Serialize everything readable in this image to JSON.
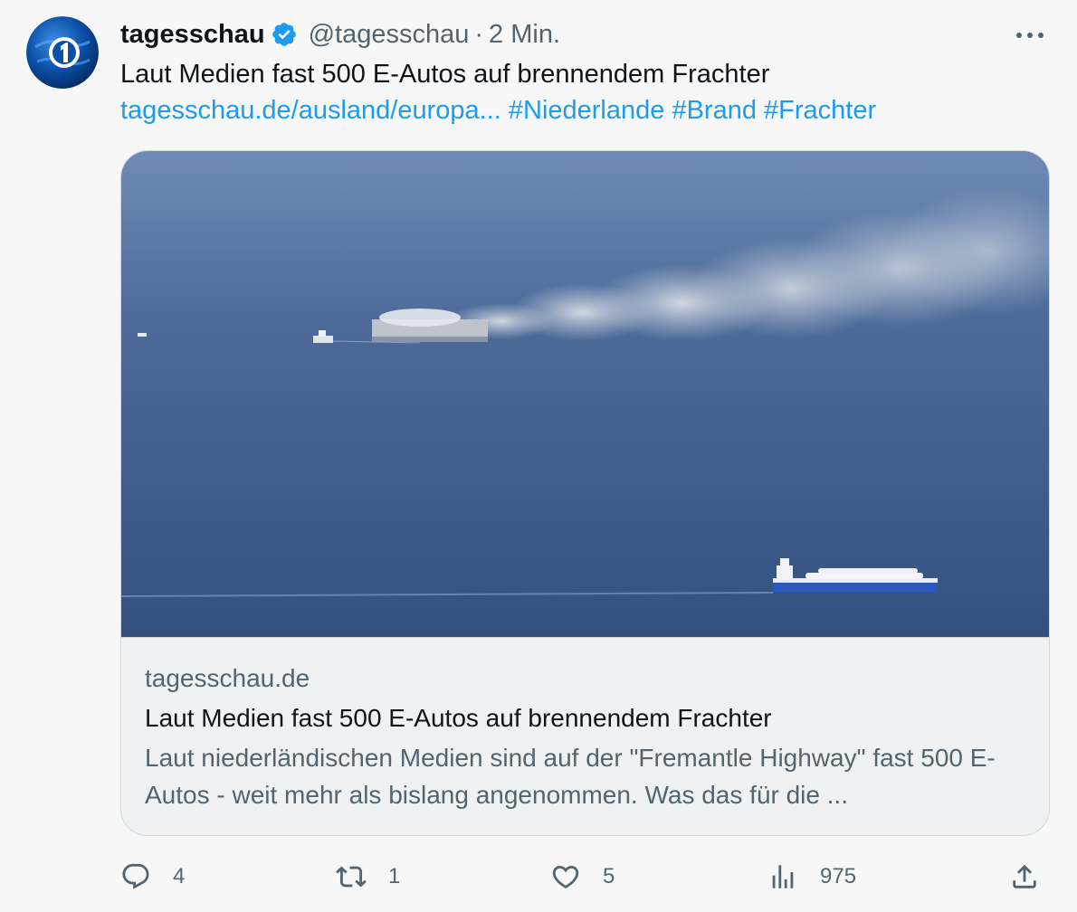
{
  "author": {
    "display_name": "tagesschau",
    "handle": "@tagesschau",
    "separator": "·",
    "time": "2 Min."
  },
  "tweet": {
    "text": "Laut Medien fast 500 E-Autos auf brennendem Frachter",
    "link": "tagesschau.de/ausland/europa...",
    "hashtags": [
      "#Niederlande",
      "#Brand",
      "#Frachter"
    ]
  },
  "card": {
    "domain": "tagesschau.de",
    "title": "Laut Medien fast 500 E-Autos auf brennendem Frachter",
    "description": "Laut niederländischen Medien sind auf der \"Fremantle Highway\" fast 500 E-Autos - weit mehr als bislang angenommen. Was das für die ..."
  },
  "actions": {
    "replies": "4",
    "retweets": "1",
    "likes": "5",
    "views": "975"
  },
  "colors": {
    "link": "#1d9bf0",
    "secondary_text": "#536471",
    "verified_badge": "#1d9bf0",
    "sea": "#3d5a8a"
  },
  "icons": [
    "tagesschau-logo-icon",
    "verified-badge-icon",
    "more-options-icon",
    "reply-icon",
    "retweet-icon",
    "like-icon",
    "views-icon",
    "share-icon"
  ]
}
